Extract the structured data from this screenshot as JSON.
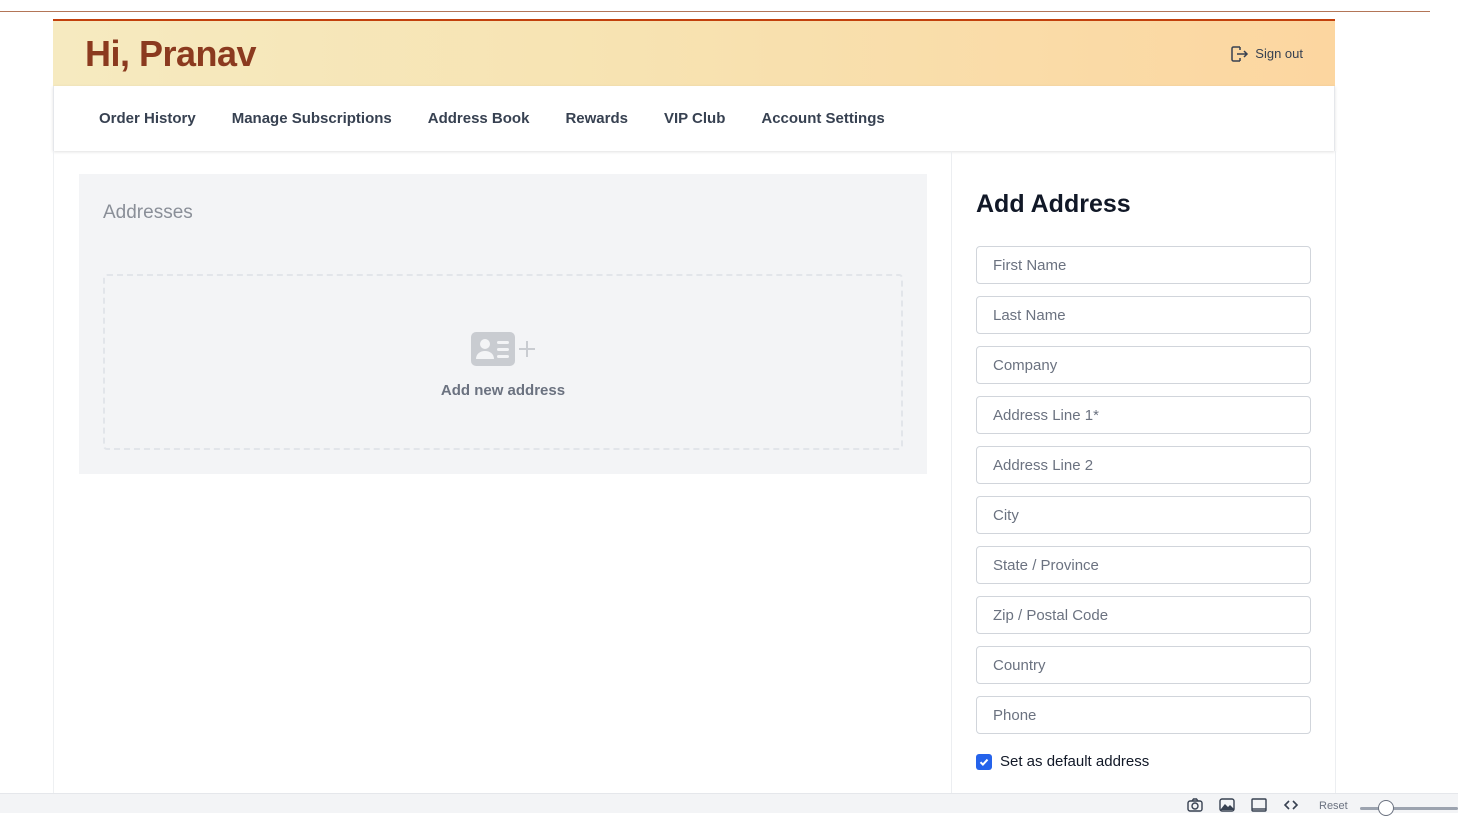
{
  "header": {
    "greeting": "Hi, Pranav",
    "signout_label": "Sign out",
    "signout_icon": "sign-out-icon"
  },
  "nav": {
    "items": [
      {
        "label": "Order History"
      },
      {
        "label": "Manage Subscriptions"
      },
      {
        "label": "Address Book"
      },
      {
        "label": "Rewards"
      },
      {
        "label": "VIP Club"
      },
      {
        "label": "Account Settings"
      }
    ]
  },
  "addresses": {
    "title": "Addresses",
    "add_label": "Add new address",
    "add_icon": "address-card-plus-icon"
  },
  "form": {
    "title": "Add Address",
    "fields": [
      {
        "placeholder": "First Name",
        "value": ""
      },
      {
        "placeholder": "Last Name",
        "value": ""
      },
      {
        "placeholder": "Company",
        "value": ""
      },
      {
        "placeholder": "Address Line 1*",
        "value": ""
      },
      {
        "placeholder": "Address Line 2",
        "value": ""
      },
      {
        "placeholder": "City",
        "value": ""
      },
      {
        "placeholder": "State / Province",
        "value": ""
      },
      {
        "placeholder": "Zip / Postal Code",
        "value": ""
      },
      {
        "placeholder": "Country",
        "value": ""
      },
      {
        "placeholder": "Phone",
        "value": ""
      }
    ],
    "default_checkbox": {
      "label": "Set as default address",
      "checked": true
    }
  },
  "toolbar": {
    "reset_label": "Reset",
    "icons": [
      "camera-icon",
      "image-icon",
      "layout-icon",
      "code-icon"
    ]
  },
  "colors": {
    "greeting": "#8b3a1f",
    "accent_border": "#c2410c",
    "checkbox": "#2563eb"
  }
}
